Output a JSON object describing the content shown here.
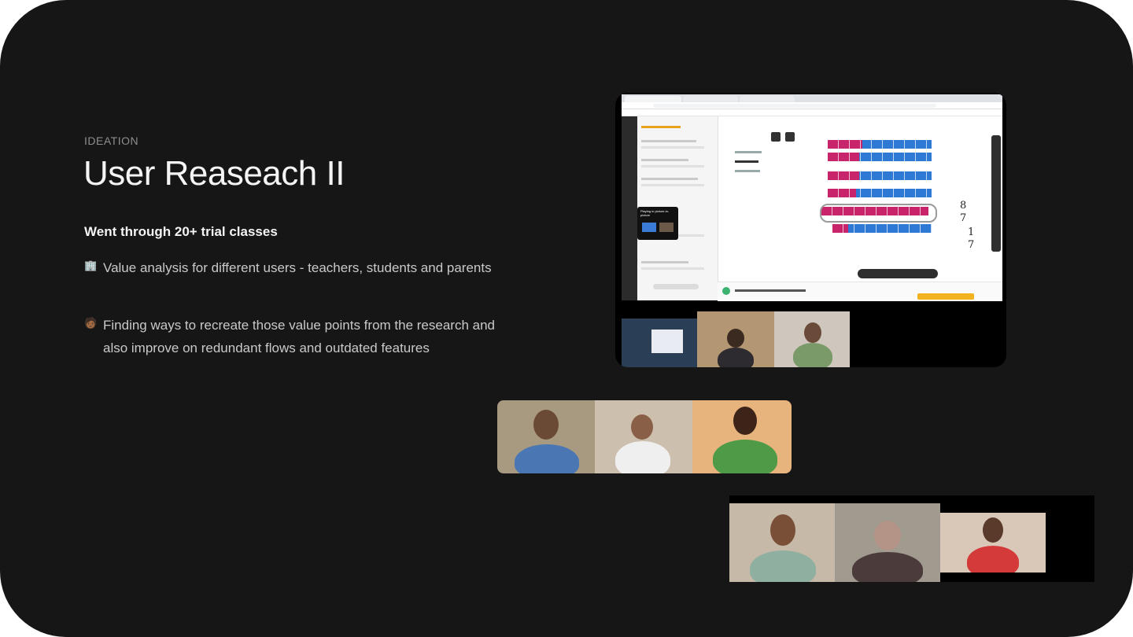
{
  "slide": {
    "eyebrow": "IDEATION",
    "title": "User Reaseach II",
    "subheading": "Went through 20+ trial classes",
    "bullets": [
      {
        "icon": "office-building-emoji",
        "emoji": "🏢",
        "text": "Value analysis for different users - teachers, students and parents"
      },
      {
        "icon": "person-emoji",
        "emoji": "🧑🏾",
        "text": "Finding ways to recreate those value points from the research and also improve on redundant flows and outdated features"
      }
    ]
  },
  "screenshots": {
    "main": {
      "description_hidden": "",
      "pip_label": "Playing in picture-in-picture"
    },
    "colors": {
      "background": "#161616",
      "accent_pink": "#c7246b",
      "accent_blue": "#2e79d4",
      "badge": "#f3b321"
    }
  }
}
